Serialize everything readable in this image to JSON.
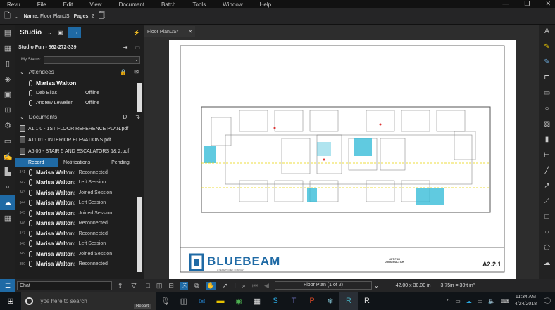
{
  "menu": [
    "Revu",
    "File",
    "Edit",
    "View",
    "Document",
    "Batch",
    "Tools",
    "Window",
    "Help"
  ],
  "toolbar": {
    "name_label": "Name:",
    "name_value": "Floor PlanUS",
    "pages_label": "Pages:",
    "pages_value": "2"
  },
  "studio": {
    "title": "Studio",
    "session": "Studio Fun - 862-272-339",
    "status_label": "My Status:",
    "status_value": ""
  },
  "attendees": {
    "header": "Attendees",
    "items": [
      {
        "name": "Marisa Walton",
        "status": ""
      },
      {
        "name": "Deb Elias",
        "status": "Offline"
      },
      {
        "name": "Andrew Lewellen",
        "status": "Offline"
      }
    ]
  },
  "documents": {
    "header": "Documents",
    "items": [
      "A1.1.0 - 1ST FLOOR REFERENCE PLAN.pdf",
      "A11.01 - INTERIOR ELEVATIONS.pdf",
      "A6.06 - STAIR 5 AND ESCALATORS 1& 2.pdf"
    ]
  },
  "record_tabs": [
    "Record",
    "Notifications",
    "Pending"
  ],
  "records": [
    {
      "n": "341",
      "name": "Marisa Walton:",
      "event": "Reconnected"
    },
    {
      "n": "342",
      "name": "Marisa Walton:",
      "event": "Left Session"
    },
    {
      "n": "343",
      "name": "Marisa Walton:",
      "event": "Joined Session"
    },
    {
      "n": "344",
      "name": "Marisa Walton:",
      "event": "Left Session"
    },
    {
      "n": "345",
      "name": "Marisa Walton:",
      "event": "Joined Session"
    },
    {
      "n": "346",
      "name": "Marisa Walton:",
      "event": "Reconnected"
    },
    {
      "n": "347",
      "name": "Marisa Walton:",
      "event": "Reconnected"
    },
    {
      "n": "348",
      "name": "Marisa Walton:",
      "event": "Left Session"
    },
    {
      "n": "349",
      "name": "Marisa Walton:",
      "event": "Joined Session"
    },
    {
      "n": "350",
      "name": "Marisa Walton:",
      "event": "Reconnected"
    }
  ],
  "chat": {
    "value": "Chat"
  },
  "doc_tab": "Floor PlanUS*",
  "titleblock": {
    "logo": "BLUEBEAM",
    "logo_sub": "A NEMETSCHEK COMPANY",
    "stamp": "NOT FOR CONSTRUCTION",
    "sheet": "A2.2.1"
  },
  "statusbar": {
    "page": "Floor Plan (1 of 2)",
    "size": "42.00 x 30.00 in",
    "scale": "3.75in = 30ft in²"
  },
  "taskbar": {
    "search_placeholder": "Type here to search",
    "time": "11:34 AM",
    "date": "4/24/2018",
    "report": "Report"
  },
  "colors": {
    "accent": "#1f6aa5",
    "highlight": "#2bb8d6",
    "bg": "#1e1e1e"
  }
}
